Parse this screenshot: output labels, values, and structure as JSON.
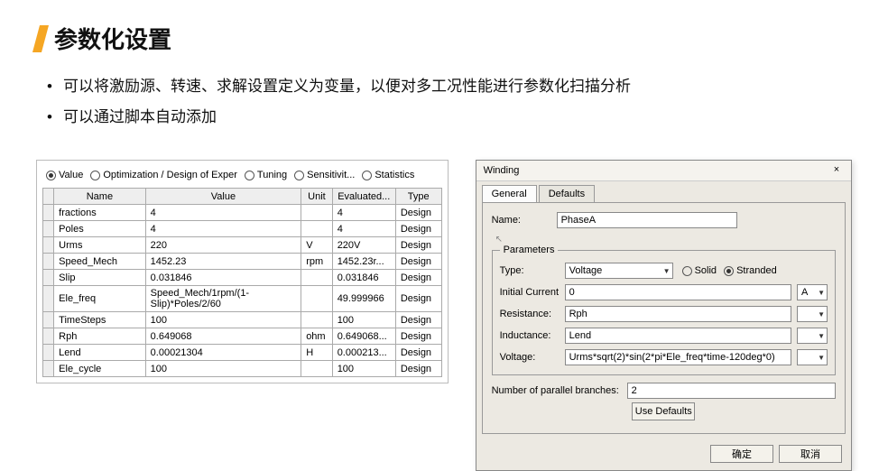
{
  "header": {
    "title": "参数化设置"
  },
  "bullets": [
    "可以将激励源、转速、求解设置定义为变量，以便对多工况性能进行参数化扫描分析",
    "可以通过脚本自动添加"
  ],
  "leftPanel": {
    "radios": [
      {
        "label": "Value",
        "checked": true
      },
      {
        "label": "Optimization / Design of Exper",
        "checked": false
      },
      {
        "label": "Tuning",
        "checked": false
      },
      {
        "label": "Sensitivit...",
        "checked": false
      },
      {
        "label": "Statistics",
        "checked": false
      }
    ],
    "columns": {
      "name": "Name",
      "value": "Value",
      "unit": "Unit",
      "eval": "Evaluated...",
      "type": "Type"
    },
    "rows": [
      {
        "name": "fractions",
        "value": "4",
        "unit": "",
        "eval": "4",
        "type": "Design"
      },
      {
        "name": "Poles",
        "value": "4",
        "unit": "",
        "eval": "4",
        "type": "Design"
      },
      {
        "name": "Urms",
        "value": "220",
        "unit": "V",
        "eval": "220V",
        "type": "Design"
      },
      {
        "name": "Speed_Mech",
        "value": "1452.23",
        "unit": "rpm",
        "eval": "1452.23r...",
        "type": "Design"
      },
      {
        "name": "Slip",
        "value": "0.031846",
        "unit": "",
        "eval": "0.031846",
        "type": "Design"
      },
      {
        "name": "Ele_freq",
        "value": "Speed_Mech/1rpm/(1-Slip)*Poles/2/60",
        "unit": "",
        "eval": "49.999966",
        "type": "Design"
      },
      {
        "name": "TimeSteps",
        "value": "100",
        "unit": "",
        "eval": "100",
        "type": "Design"
      },
      {
        "name": "Rph",
        "value": "0.649068",
        "unit": "ohm",
        "eval": "0.649068...",
        "type": "Design"
      },
      {
        "name": "Lend",
        "value": "0.00021304",
        "unit": "H",
        "eval": "0.000213...",
        "type": "Design"
      },
      {
        "name": "Ele_cycle",
        "value": "100",
        "unit": "",
        "eval": "100",
        "type": "Design"
      }
    ]
  },
  "dialog": {
    "title": "Winding",
    "close": "×",
    "tabs": {
      "general": "General",
      "defaults": "Defaults"
    },
    "nameLabel": "Name:",
    "nameValue": "PhaseA",
    "paramsLegend": "Parameters",
    "typeLabel": "Type:",
    "typeValue": "Voltage",
    "solidLabel": "Solid",
    "strandedLabel": "Stranded",
    "initCurrentLabel": "Initial Current",
    "initCurrentValue": "0",
    "initCurrentUnit": "A",
    "resistanceLabel": "Resistance:",
    "resistanceValue": "Rph",
    "inductanceLabel": "Inductance:",
    "inductanceValue": "Lend",
    "voltageLabel": "Voltage:",
    "voltageValue": "Urms*sqrt(2)*sin(2*pi*Ele_freq*time-120deg*0)",
    "npbLabel": "Number of parallel branches:",
    "npbValue": "2",
    "useDefaults": "Use Defaults",
    "ok": "确定",
    "cancel": "取消"
  }
}
